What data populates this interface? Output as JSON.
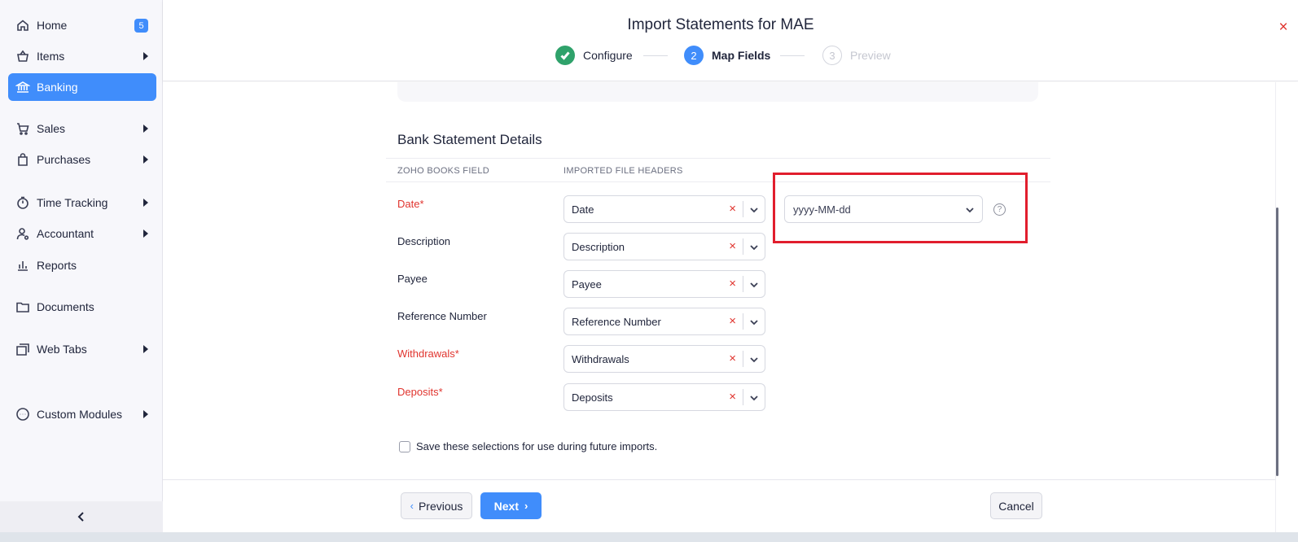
{
  "sidebar": {
    "items": [
      {
        "label": "Home",
        "icon": "home-icon",
        "badge": "5"
      },
      {
        "label": "Items",
        "icon": "basket-icon"
      },
      {
        "label": "Banking",
        "icon": "bank-icon"
      },
      {
        "label": "Sales",
        "icon": "cart-icon"
      },
      {
        "label": "Purchases",
        "icon": "bag-icon"
      },
      {
        "label": "Time Tracking",
        "icon": "timer-icon"
      },
      {
        "label": "Accountant",
        "icon": "user-gear-icon"
      },
      {
        "label": "Reports",
        "icon": "bar-chart-icon"
      },
      {
        "label": "Documents",
        "icon": "folder-icon"
      },
      {
        "label": "Web Tabs",
        "icon": "tabs-icon"
      },
      {
        "label": "Custom Modules",
        "icon": "dots-circle-icon"
      }
    ],
    "active": "Banking"
  },
  "header": {
    "title": "Import Statements for MAE",
    "close_glyph": "×",
    "steps": [
      {
        "number": "1",
        "label": "Configure",
        "state": "completed"
      },
      {
        "number": "2",
        "label": "Map Fields",
        "state": "active"
      },
      {
        "number": "3",
        "label": "Preview",
        "state": "pending"
      }
    ]
  },
  "mapping": {
    "section_title": "Bank Statement Details",
    "columns": [
      "ZOHO BOOKS FIELD",
      "IMPORTED FILE HEADERS"
    ],
    "rows": [
      {
        "field": "Date*",
        "required": true,
        "value": "Date"
      },
      {
        "field": "Description",
        "required": false,
        "value": "Description"
      },
      {
        "field": "Payee",
        "required": false,
        "value": "Payee"
      },
      {
        "field": "Reference Number",
        "required": false,
        "value": "Reference Number"
      },
      {
        "field": "Withdrawals*",
        "required": true,
        "value": "Withdrawals"
      },
      {
        "field": "Deposits*",
        "required": true,
        "value": "Deposits"
      }
    ],
    "date_format": "yyyy-MM-dd",
    "help_glyph": "?",
    "save_selections_label": "Save these selections for use during future imports."
  },
  "footer": {
    "previous_label": "Previous",
    "next_label": "Next",
    "cancel_label": "Cancel"
  },
  "colors": {
    "accent": "#408dfb",
    "required": "#e0342e",
    "highlight": "#e11e2d",
    "success": "#2fa26b"
  }
}
